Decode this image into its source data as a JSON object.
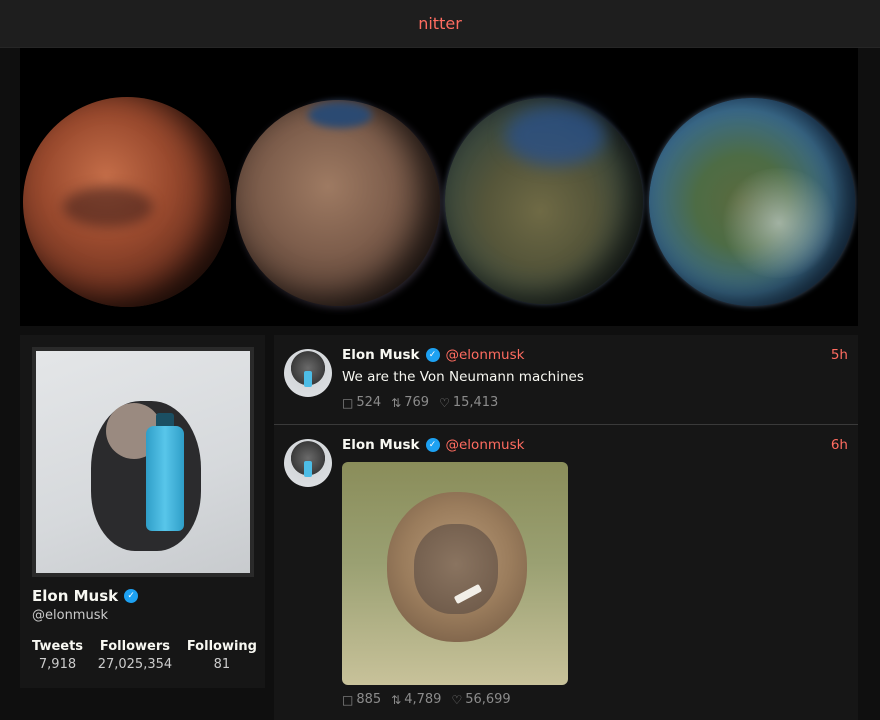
{
  "topbar": {
    "brand": "nitter"
  },
  "profile": {
    "name": "Elon Musk",
    "verified_mark": "✓",
    "handle": "@elonmusk",
    "stats": [
      {
        "label": "Tweets",
        "value": "7,918"
      },
      {
        "label": "Followers",
        "value": "27,025,354"
      },
      {
        "label": "Following",
        "value": "81"
      }
    ]
  },
  "tweets": [
    {
      "name": "Elon Musk",
      "verified_mark": "✓",
      "handle": "@elonmusk",
      "time": "5h",
      "text": "We are the Von Neumann machines",
      "replies": "524",
      "retweets": "769",
      "likes": "15,413"
    },
    {
      "name": "Elon Musk",
      "verified_mark": "✓",
      "handle": "@elonmusk",
      "time": "6h",
      "text": "",
      "replies": "885",
      "retweets": "4,789",
      "likes": "56,699"
    }
  ],
  "icons": {
    "reply": "comment-icon",
    "retweet": "retweet-icon",
    "like": "heart-icon",
    "verified": "verified-icon"
  },
  "colors": {
    "accent": "#ff6c60",
    "verified": "#1da1f2",
    "background": "#0f0f0f",
    "panel": "#161616"
  }
}
